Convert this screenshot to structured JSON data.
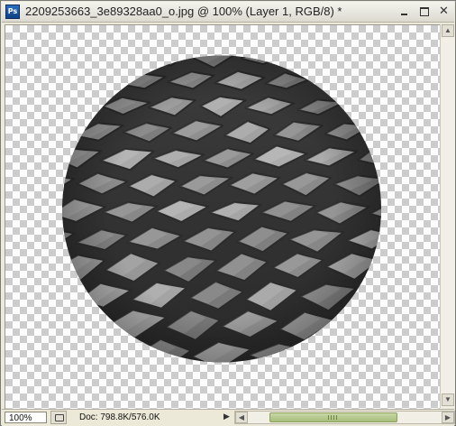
{
  "window": {
    "title": "2209253663_3e89328aa0_o.jpg @ 100% (Layer 1, RGB/8) *",
    "app_icon_label": "Ps",
    "minimize_icon": "minimize-icon",
    "maximize_icon": "maximize-icon",
    "close_label": "✕"
  },
  "canvas": {
    "background": "transparency-checkerboard",
    "image": "circular-cropped-cobblestone-photo"
  },
  "status": {
    "zoom": "100%",
    "doc_info": "Doc: 798.8K/576.0K",
    "more_arrow": "▶"
  },
  "scrollbars": {
    "up_arrow": "▲",
    "down_arrow": "▼",
    "left_arrow": "◀",
    "right_arrow": "▶"
  },
  "colors": {
    "accent": "#a7bd7b",
    "chrome": "#ece9d8"
  }
}
